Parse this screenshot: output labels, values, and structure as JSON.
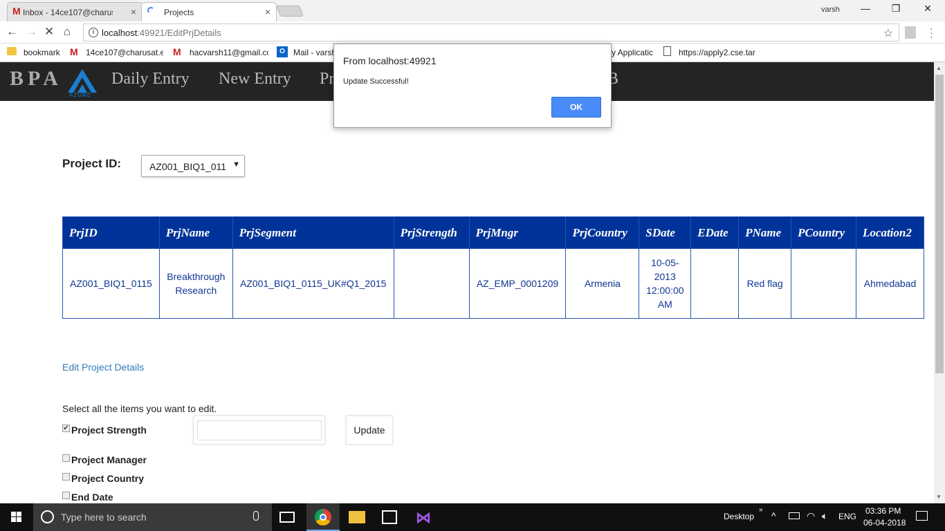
{
  "browser": {
    "tabs": [
      {
        "label": "Inbox - 14ce107@charus",
        "close": "×"
      },
      {
        "label": "Projects",
        "close": "×"
      }
    ],
    "user": "varsh",
    "window_controls": {
      "minimize": "—",
      "restore": "❐",
      "close": "✕"
    },
    "url_host": "localhost",
    "url_rest": ":49921/EditPrjDetails",
    "bookmarks": [
      "bookmark",
      "14ce107@charusat.ec",
      "hacvarsh11@gmail.cc",
      "Mail - varsh",
      "y Applicatic",
      "https://apply2.cse.tar"
    ]
  },
  "app": {
    "logo": "BPA",
    "logo_sub": "AZURE",
    "nav": [
      "Daily Entry",
      "New Entry",
      "Pr",
      "B"
    ]
  },
  "page": {
    "project_id_label": "Project ID:",
    "project_id_value": "AZ001_BIQ1_011",
    "table": {
      "headers": [
        "PrjID",
        "PrjName",
        "PrjSegment",
        "PrjStrength",
        "PrjMngr",
        "PrjCountry",
        "SDate",
        "EDate",
        "PName",
        "PCountry",
        "Location2"
      ],
      "rows": [
        [
          "AZ001_BIQ1_0115",
          "Breakthrough Research",
          "AZ001_BIQ1_0115_UK#Q1_2015",
          "",
          "AZ_EMP_0001209",
          "Armenia",
          "10-05-2013 12:00:00 AM",
          "",
          "Red flag",
          "",
          "Ahmedabad"
        ]
      ]
    },
    "edit_link": "Edit Project Details",
    "select_prompt": "Select all the items you want to edit.",
    "checkboxes": [
      {
        "label": "Project Strength",
        "checked": true
      },
      {
        "label": "Project Manager",
        "checked": false
      },
      {
        "label": "Project Country",
        "checked": false
      },
      {
        "label": "End Date",
        "checked": false
      }
    ],
    "update_button": "Update"
  },
  "dialog": {
    "title": "From localhost:49921",
    "message": "Update Successful!",
    "ok": "OK"
  },
  "taskbar": {
    "search_placeholder": "Type here to search",
    "desktop": "Desktop",
    "lang": "ENG",
    "time": "03:36 PM",
    "date": "06-04-2018"
  }
}
